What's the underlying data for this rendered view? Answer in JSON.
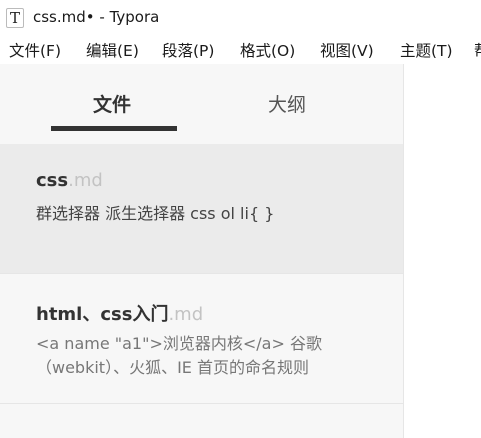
{
  "window": {
    "title": "css.md• - Typora",
    "app_icon_glyph": "T"
  },
  "menu": {
    "items": [
      {
        "label": "文件(F)"
      },
      {
        "label": "编辑(E)"
      },
      {
        "label": "段落(P)"
      },
      {
        "label": "格式(O)"
      },
      {
        "label": "视图(V)"
      },
      {
        "label": "主题(T)"
      },
      {
        "label": "帮"
      }
    ]
  },
  "sidebar": {
    "tabs": [
      {
        "label": "文件",
        "active": true
      },
      {
        "label": "大纲",
        "active": false
      }
    ],
    "files": [
      {
        "name": "css",
        "ext": ".md",
        "excerpt_lines": [
          "群选择器 派生选择器 css ol li{ }"
        ],
        "active": true
      },
      {
        "name": "html、css入门",
        "ext": ".md",
        "excerpt_lines": [
          "<a name \"a1\">浏览器内核</a> 谷歌",
          "（webkit）、火狐、IE 首页的命名规则"
        ],
        "active": false
      }
    ]
  },
  "colors": {
    "sidebar_bg": "#f7f7f7",
    "active_item_bg": "#ebebeb",
    "tab_underline": "#333333",
    "extension_text": "#c3c3c3"
  }
}
